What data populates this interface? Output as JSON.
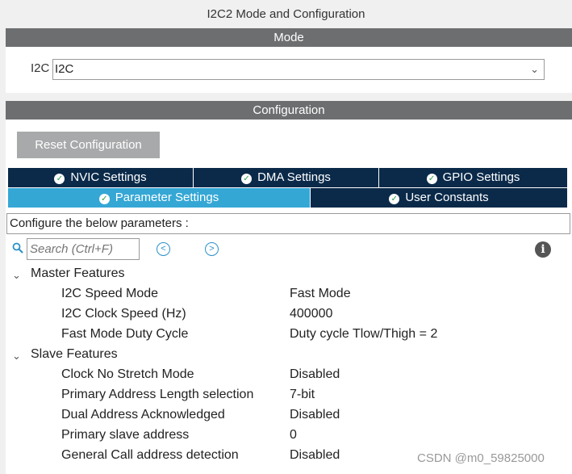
{
  "window": {
    "title": "I2C2 Mode and Configuration"
  },
  "mode": {
    "header": "Mode",
    "label": "I2C",
    "select_value": "I2C"
  },
  "configuration": {
    "header": "Configuration",
    "reset_label": "Reset Configuration",
    "tabs": [
      {
        "label": "NVIC Settings"
      },
      {
        "label": "DMA Settings"
      },
      {
        "label": "GPIO Settings"
      },
      {
        "label": "Parameter Settings",
        "active": true
      },
      {
        "label": "User Constants"
      }
    ],
    "description": "Configure the below parameters :",
    "search_placeholder": "Search (Ctrl+F)",
    "groups": [
      {
        "label": "Master Features",
        "params": [
          {
            "name": "I2C Speed Mode",
            "value": "Fast Mode"
          },
          {
            "name": "I2C Clock Speed (Hz)",
            "value": "400000"
          },
          {
            "name": "Fast Mode Duty Cycle",
            "value": "Duty cycle Tlow/Thigh = 2"
          }
        ]
      },
      {
        "label": "Slave Features",
        "params": [
          {
            "name": "Clock No Stretch Mode",
            "value": "Disabled"
          },
          {
            "name": "Primary Address Length selection",
            "value": "7-bit"
          },
          {
            "name": "Dual Address Acknowledged",
            "value": "Disabled"
          },
          {
            "name": "Primary slave address",
            "value": "0"
          },
          {
            "name": "General Call address detection",
            "value": "Disabled"
          }
        ]
      }
    ]
  },
  "watermark": "CSDN @m0_59825000",
  "colors": {
    "header_gray": "#6d6e70",
    "tab_dark": "#0b2a4a",
    "tab_active": "#35a7d5"
  }
}
